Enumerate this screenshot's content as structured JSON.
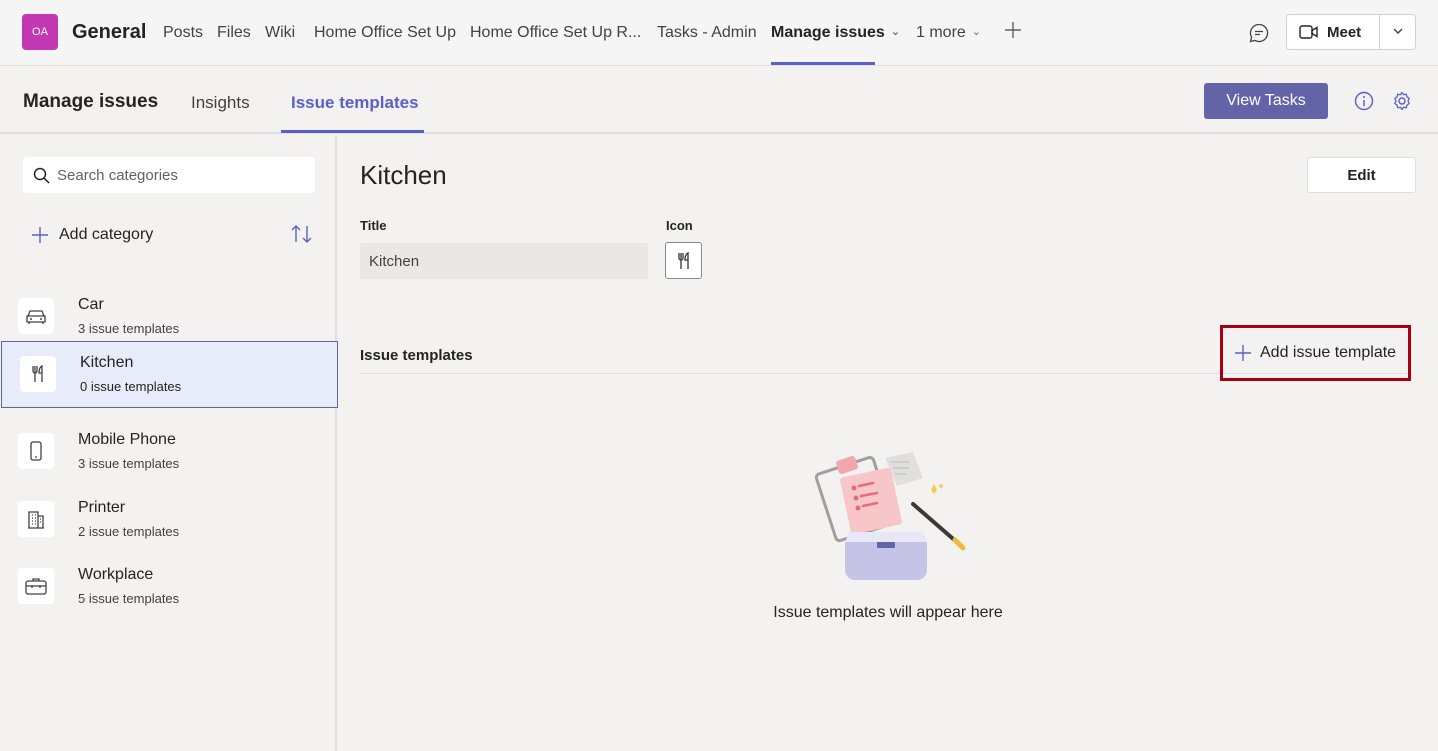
{
  "team": {
    "avatar_initials": "OA",
    "channel_name": "General"
  },
  "channel_tabs": [
    {
      "label": "Posts"
    },
    {
      "label": "Files"
    },
    {
      "label": "Wiki"
    },
    {
      "label": "Home Office Set Up"
    },
    {
      "label": "Home Office Set Up R..."
    },
    {
      "label": "Tasks - Admin"
    },
    {
      "label": "Manage issues",
      "active": true
    },
    {
      "label": "1 more"
    }
  ],
  "meet": {
    "label": "Meet"
  },
  "app": {
    "title": "Manage issues",
    "tabs": [
      {
        "label": "Insights"
      },
      {
        "label": "Issue templates",
        "active": true
      }
    ],
    "view_tasks_label": "View Tasks"
  },
  "sidebar": {
    "search_placeholder": "Search categories",
    "add_category_label": "Add category",
    "categories": [
      {
        "name": "Car",
        "count": "3 issue templates",
        "icon": "car-icon"
      },
      {
        "name": "Kitchen",
        "count": "0 issue templates",
        "icon": "utensils-icon",
        "selected": true
      },
      {
        "name": "Mobile Phone",
        "count": "3 issue templates",
        "icon": "phone-icon"
      },
      {
        "name": "Printer",
        "count": "2 issue templates",
        "icon": "building-icon"
      },
      {
        "name": "Workplace",
        "count": "5 issue templates",
        "icon": "briefcase-icon"
      }
    ]
  },
  "detail": {
    "title": "Kitchen",
    "edit_label": "Edit",
    "title_field_label": "Title",
    "title_field_value": "Kitchen",
    "icon_field_label": "Icon",
    "icon_value": "utensils-icon",
    "section_title": "Issue templates",
    "add_template_label": "Add issue template",
    "empty_text": "Issue templates will appear here"
  },
  "colors": {
    "accent": "#6264a7",
    "avatar": "#c239b3",
    "highlight_border": "#a4000f",
    "selected_bg": "#e8ebfa"
  }
}
